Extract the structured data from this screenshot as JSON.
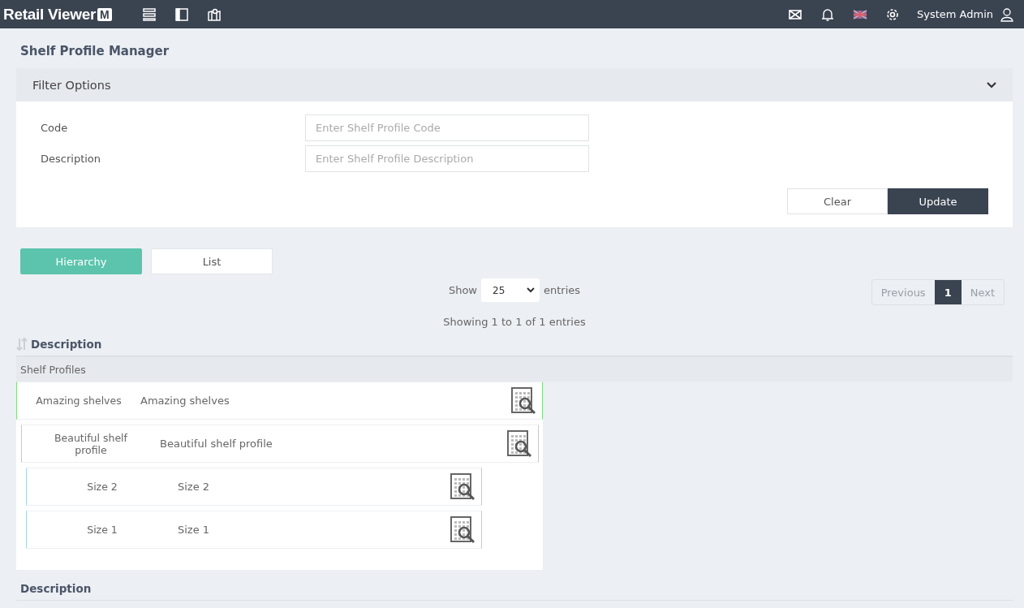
{
  "topbar": {
    "logo_text": "Retail Viewer",
    "logo_badge": "M",
    "user": "System Admin"
  },
  "page_title": "Shelf Profile Manager",
  "filter": {
    "title": "Filter Options",
    "expanded": true,
    "fields": [
      {
        "label": "Code",
        "placeholder": "Enter Shelf Profile Code"
      },
      {
        "label": "Description",
        "placeholder": "Enter Shelf Profile Description"
      }
    ],
    "buttons": [
      {
        "label": "Clear",
        "kind": "secondary"
      },
      {
        "label": "Update",
        "kind": "primary"
      }
    ]
  },
  "view_tabs": [
    {
      "label": "Hierarchy",
      "selected": true
    },
    {
      "label": "List",
      "selected": false
    }
  ],
  "length": {
    "before": "Show",
    "value": "25",
    "after": "entries"
  },
  "info": "Showing 1 to 1 of 1 entries",
  "pagination": [
    {
      "label": "Previous",
      "selected": false,
      "disabled": true
    },
    {
      "label": "1",
      "selected": true,
      "disabled": false
    },
    {
      "label": "Next",
      "selected": false,
      "disabled": true
    }
  ],
  "table": {
    "header": "Description",
    "group": "Shelf Profiles",
    "footer": "Description",
    "rows": [
      {
        "code": "Amazing shelves",
        "description": "Amazing shelves",
        "children": [
          {
            "code": "Beautiful shelf profile",
            "description": "Beautiful shelf profile",
            "children": [
              {
                "code": "Size 2",
                "description": "Size 2"
              },
              {
                "code": "Size 1",
                "description": "Size 1"
              }
            ]
          }
        ]
      }
    ]
  }
}
